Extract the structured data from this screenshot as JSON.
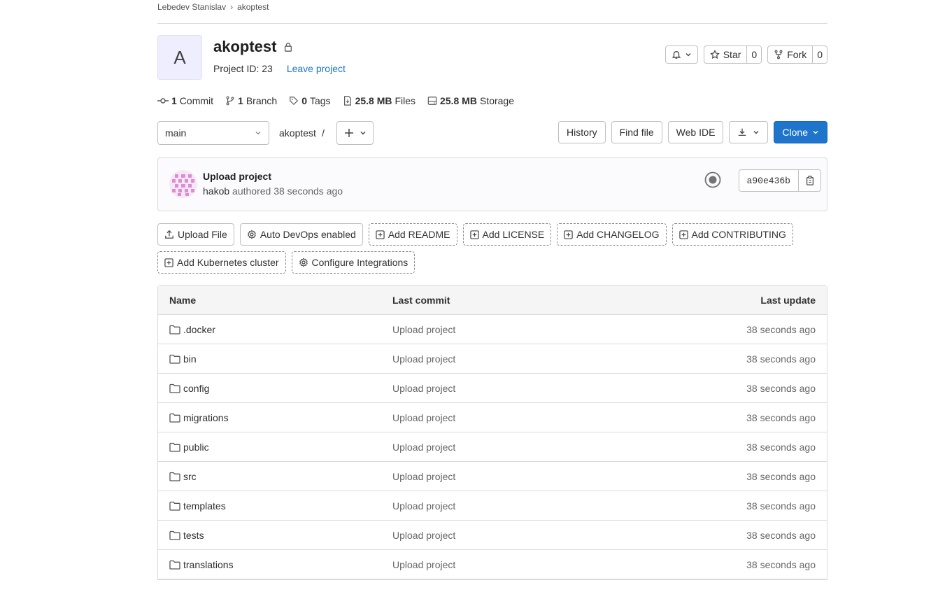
{
  "breadcrumb": {
    "owner": "Lebedev Stanislav",
    "project": "akoptest"
  },
  "project": {
    "initial": "A",
    "name": "akoptest",
    "id_label": "Project ID: 23",
    "leave_label": "Leave project"
  },
  "header_actions": {
    "star_label": "Star",
    "star_count": "0",
    "fork_label": "Fork",
    "fork_count": "0"
  },
  "stats": {
    "commits_count": "1",
    "commits_label": "Commit",
    "branches_count": "1",
    "branches_label": "Branch",
    "tags_count": "0",
    "tags_label": "Tags",
    "files_size": "25.8 MB",
    "files_label": "Files",
    "storage_size": "25.8 MB",
    "storage_label": "Storage"
  },
  "tree": {
    "branch": "main",
    "path": "akoptest",
    "history_label": "History",
    "find_file_label": "Find file",
    "web_ide_label": "Web IDE",
    "clone_label": "Clone"
  },
  "commit": {
    "title": "Upload project",
    "author": "hakob",
    "meta": "authored 38 seconds ago",
    "sha": "a90e436b"
  },
  "actions": [
    {
      "label": "Upload File",
      "style": "solid"
    },
    {
      "label": "Auto DevOps enabled",
      "style": "solid"
    },
    {
      "label": "Add README",
      "style": "dashed"
    },
    {
      "label": "Add LICENSE",
      "style": "dashed"
    },
    {
      "label": "Add CHANGELOG",
      "style": "dashed"
    },
    {
      "label": "Add CONTRIBUTING",
      "style": "dashed"
    },
    {
      "label": "Add Kubernetes cluster",
      "style": "dashed"
    },
    {
      "label": "Configure Integrations",
      "style": "dashed"
    }
  ],
  "table": {
    "headers": {
      "name": "Name",
      "last_commit": "Last commit",
      "last_update": "Last update"
    },
    "rows": [
      {
        "name": ".docker",
        "commit": "Upload project",
        "updated": "38 seconds ago"
      },
      {
        "name": "bin",
        "commit": "Upload project",
        "updated": "38 seconds ago"
      },
      {
        "name": "config",
        "commit": "Upload project",
        "updated": "38 seconds ago"
      },
      {
        "name": "migrations",
        "commit": "Upload project",
        "updated": "38 seconds ago"
      },
      {
        "name": "public",
        "commit": "Upload project",
        "updated": "38 seconds ago"
      },
      {
        "name": "src",
        "commit": "Upload project",
        "updated": "38 seconds ago"
      },
      {
        "name": "templates",
        "commit": "Upload project",
        "updated": "38 seconds ago"
      },
      {
        "name": "tests",
        "commit": "Upload project",
        "updated": "38 seconds ago"
      },
      {
        "name": "translations",
        "commit": "Upload project",
        "updated": "38 seconds ago"
      }
    ]
  },
  "colors": {
    "primary": "#1f75cb",
    "border": "#dbdbdb",
    "text": "#303030",
    "muted": "#666666"
  }
}
